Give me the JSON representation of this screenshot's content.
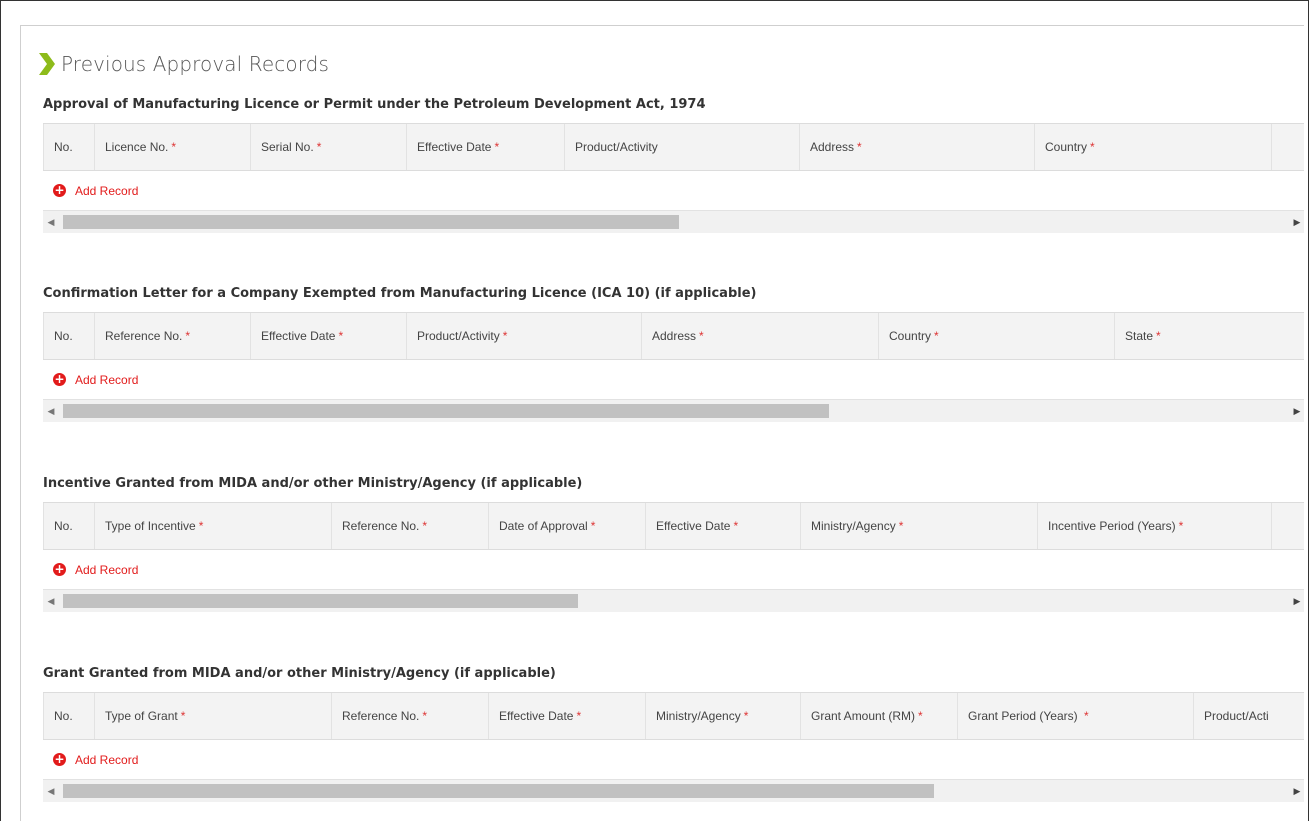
{
  "panel": {
    "title": "Previous Approval Records"
  },
  "sections": [
    {
      "heading": "Approval of Manufacturing Licence or Permit under the Petroleum Development Act, 1974",
      "columns": [
        {
          "label": "No.",
          "required": false
        },
        {
          "label": "Licence No.",
          "required": true
        },
        {
          "label": "Serial No.",
          "required": true
        },
        {
          "label": "Effective Date",
          "required": true
        },
        {
          "label": "Product/Activity",
          "required": false
        },
        {
          "label": "Address",
          "required": true
        },
        {
          "label": "Country",
          "required": true
        }
      ],
      "add_label": "Add Record"
    },
    {
      "heading": "Confirmation Letter for a Company Exempted from Manufacturing Licence (ICA 10) (if applicable)",
      "columns": [
        {
          "label": "No.",
          "required": false
        },
        {
          "label": "Reference No.",
          "required": true
        },
        {
          "label": "Effective Date",
          "required": true
        },
        {
          "label": "Product/Activity",
          "required": true
        },
        {
          "label": "Address",
          "required": true
        },
        {
          "label": "Country",
          "required": true
        },
        {
          "label": "State",
          "required": true
        }
      ],
      "add_label": "Add Record"
    },
    {
      "heading": "Incentive Granted from MIDA and/or other Ministry/Agency (if applicable)",
      "columns": [
        {
          "label": "No.",
          "required": false
        },
        {
          "label": "Type of Incentive",
          "required": true
        },
        {
          "label": "Reference No.",
          "required": true
        },
        {
          "label": "Date of Approval",
          "required": true
        },
        {
          "label": "Effective Date",
          "required": true
        },
        {
          "label": "Ministry/Agency",
          "required": true
        },
        {
          "label": "Incentive Period (Years)",
          "required": true
        }
      ],
      "add_label": "Add Record"
    },
    {
      "heading": "Grant Granted from MIDA and/or other Ministry/Agency (if applicable)",
      "columns": [
        {
          "label": "No.",
          "required": false
        },
        {
          "label": "Type of Grant",
          "required": true
        },
        {
          "label": "Reference No.",
          "required": true
        },
        {
          "label": "Effective Date",
          "required": true
        },
        {
          "label": "Ministry/Agency",
          "required": true
        },
        {
          "label": "Grant Amount (RM)",
          "required": true
        },
        {
          "label": "Grant Period (Years) ",
          "required": true
        },
        {
          "label": "Product/Acti",
          "required": false
        }
      ],
      "add_label": "Add Record"
    }
  ],
  "icons": {
    "add": "plus-circle-icon",
    "title_marker": "chevron-right-icon",
    "scroll_left": "arrow-left-icon",
    "scroll_right": "arrow-right-icon"
  },
  "colors": {
    "accent_green": "#8dbb1a",
    "required_red": "#dd3333",
    "add_red": "#e21b1b"
  }
}
